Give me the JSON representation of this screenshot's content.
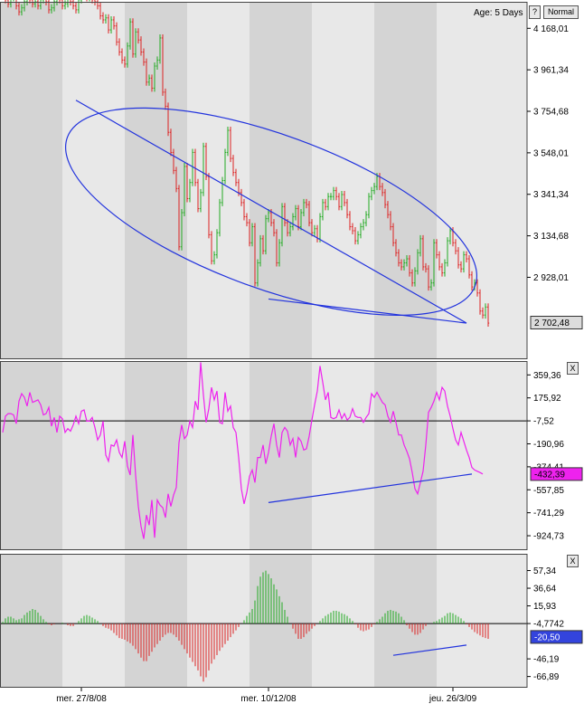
{
  "header": {
    "age_label": "Age: 5 Days",
    "help_button": "?",
    "mode_button": "Normal"
  },
  "close_buttons": [
    "X",
    "X"
  ],
  "x_axis": {
    "labels": [
      {
        "text": "mer. 27/8/08",
        "slot": 29
      },
      {
        "text": "mer. 10/12/08",
        "slot": 98
      },
      {
        "text": "jeu. 26/3/09",
        "slot": 166
      }
    ]
  },
  "colors": {
    "up": "#22aa22",
    "down": "#dd2222",
    "oscillator": "#ee22ee",
    "drawing": "#2233dd",
    "band_dark": "#d4d4d4",
    "band_light": "#e8e8e8",
    "zero_line": "#000000"
  },
  "chart_data": [
    {
      "type": "ohlc",
      "panel": "price",
      "ylim": [
        2520,
        4300
      ],
      "y_ticks": [
        "4 168,01",
        "3 961,34",
        "3 754,68",
        "3 548,01",
        "3 341,34",
        "3 134,68",
        "2 928,01"
      ],
      "last_value_label": "2 702,48",
      "close": [
        4330,
        4310,
        4290,
        4320,
        4340,
        4280,
        4250,
        4270,
        4300,
        4320,
        4310,
        4290,
        4300,
        4280,
        4310,
        4330,
        4300,
        4260,
        4270,
        4300,
        4330,
        4310,
        4280,
        4290,
        4320,
        4300,
        4280,
        4260,
        4310,
        4340,
        4330,
        4320,
        4340,
        4310,
        4300,
        4280,
        4230,
        4210,
        4220,
        4160,
        4210,
        4180,
        4100,
        4050,
        4010,
        3990,
        4080,
        4200,
        4040,
        4150,
        4110,
        4050,
        4000,
        3900,
        3920,
        3870,
        3980,
        4010,
        4120,
        3850,
        3780,
        3650,
        3550,
        3460,
        3370,
        3080,
        3250,
        3480,
        3320,
        3400,
        3550,
        3400,
        3270,
        3350,
        3580,
        3430,
        3140,
        3010,
        3040,
        3150,
        3300,
        3410,
        3550,
        3660,
        3520,
        3450,
        3400,
        3350,
        3300,
        3230,
        3200,
        3100,
        3180,
        2900,
        3000,
        3120,
        3060,
        3220,
        3250,
        3200,
        3150,
        3000,
        3100,
        3280,
        3200,
        3150,
        3180,
        3230,
        3270,
        3180,
        3250,
        3300,
        3290,
        3200,
        3150,
        3170,
        3120,
        3230,
        3300,
        3280,
        3330,
        3330,
        3360,
        3330,
        3280,
        3340,
        3300,
        3240,
        3180,
        3160,
        3110,
        3140,
        3180,
        3200,
        3240,
        3330,
        3360,
        3380,
        3430,
        3380,
        3350,
        3290,
        3240,
        3180,
        3100,
        3050,
        3000,
        2980,
        3000,
        3020,
        2950,
        2900,
        2960,
        3050,
        3120,
        2980,
        2970,
        2880,
        2900,
        3100,
        3040,
        2980,
        2950,
        3000,
        3110,
        3160,
        3100,
        3060,
        2990,
        2970,
        3040,
        3020,
        2940,
        2880,
        2900,
        2850,
        2760,
        2740,
        2780,
        2700
      ]
    },
    {
      "type": "line",
      "panel": "oscillator",
      "ylim": [
        -1040,
        470
      ],
      "y_ticks": [
        "359,36",
        "175,92",
        "-7,52",
        "-190,96",
        "-374,41",
        "-557,85",
        "-741,29",
        "-924,73"
      ],
      "last_value_label": "-432,39",
      "values": [
        -100,
        30,
        50,
        50,
        40,
        -30,
        150,
        210,
        180,
        110,
        220,
        140,
        150,
        160,
        120,
        40,
        50,
        100,
        -50,
        20,
        -100,
        30,
        10,
        -100,
        -70,
        -90,
        -40,
        30,
        -30,
        70,
        80,
        -10,
        -10,
        20,
        -60,
        -160,
        -120,
        -10,
        -280,
        -330,
        -200,
        -210,
        -160,
        -260,
        -300,
        -170,
        -370,
        -440,
        -120,
        -440,
        -690,
        -850,
        -950,
        -760,
        -840,
        -640,
        -940,
        -640,
        -680,
        -700,
        -780,
        -590,
        -690,
        -600,
        -540,
        -180,
        -40,
        -150,
        -120,
        -10,
        -60,
        150,
        80,
        460,
        200,
        -20,
        90,
        260,
        160,
        230,
        -20,
        -30,
        220,
        70,
        110,
        -60,
        -100,
        -300,
        -550,
        -670,
        -580,
        -450,
        -400,
        -500,
        -300,
        -300,
        -200,
        -350,
        -260,
        -130,
        -30,
        -200,
        -300,
        -100,
        -60,
        -90,
        -200,
        -150,
        -300,
        -140,
        -170,
        -240,
        -230,
        -130,
        0,
        120,
        230,
        430,
        300,
        160,
        220,
        20,
        10,
        20,
        80,
        10,
        50,
        0,
        20,
        90,
        30,
        20,
        20,
        -20,
        20,
        50,
        210,
        180,
        220,
        180,
        140,
        120,
        30,
        -20,
        70,
        -20,
        -120,
        -120,
        -200,
        -250,
        -310,
        -420,
        -550,
        -590,
        -500,
        -410,
        -200,
        60,
        100,
        150,
        220,
        160,
        260,
        230,
        110,
        30,
        -70,
        -160,
        -200,
        -100,
        -170,
        -240,
        -300,
        -380,
        -400,
        -410,
        -420,
        -432
      ]
    },
    {
      "type": "bar",
      "panel": "histogram",
      "ylim": [
        -80,
        77
      ],
      "y_ticks": [
        "57,34",
        "36,64",
        "15,93",
        "-4,7742",
        "-46,19",
        "-66,89"
      ],
      "last_value_label": "-20,50",
      "values": [
        2,
        6,
        8,
        8,
        6,
        4,
        5,
        6,
        10,
        13,
        15,
        17,
        16,
        13,
        9,
        5,
        2,
        -1,
        -2,
        -1,
        0,
        0,
        1,
        0,
        -2,
        -3,
        -3,
        0,
        3,
        6,
        9,
        10,
        9,
        7,
        5,
        3,
        0,
        -3,
        -5,
        -6,
        -8,
        -11,
        -14,
        -17,
        -18,
        -19,
        -21,
        -23,
        -26,
        -30,
        -35,
        -40,
        -44,
        -44,
        -38,
        -33,
        -28,
        -24,
        -20,
        -16,
        -13,
        -11,
        -11,
        -13,
        -16,
        -20,
        -25,
        -30,
        -35,
        -40,
        -45,
        -50,
        -55,
        -62,
        -68,
        -63,
        -55,
        -47,
        -42,
        -37,
        -32,
        -28,
        -24,
        -20,
        -16,
        -12,
        -8,
        -4,
        0,
        4,
        9,
        13,
        17,
        27,
        44,
        55,
        60,
        62,
        58,
        53,
        46,
        40,
        32,
        25,
        16,
        8,
        0,
        -6,
        -12,
        -18,
        -18,
        -16,
        -12,
        -9,
        -6,
        -3,
        0,
        3,
        6,
        9,
        11,
        13,
        15,
        15,
        14,
        12,
        11,
        9,
        6,
        3,
        -1,
        -5,
        -8,
        -9,
        -8,
        -7,
        -4,
        -1,
        2,
        5,
        8,
        12,
        15,
        16,
        15,
        14,
        12,
        8,
        4,
        -2,
        -6,
        -10,
        -13,
        -13,
        -11,
        -7,
        -3,
        0,
        0,
        2,
        3,
        5,
        7,
        9,
        12,
        13,
        12,
        10,
        8,
        6,
        3,
        -1,
        -4,
        -7,
        -10,
        -12,
        -14,
        -16,
        -17,
        -18,
        -19,
        -20,
        -20,
        -20,
        -20,
        -20,
        -20,
        -20,
        -20,
        -20,
        -20
      ]
    }
  ]
}
